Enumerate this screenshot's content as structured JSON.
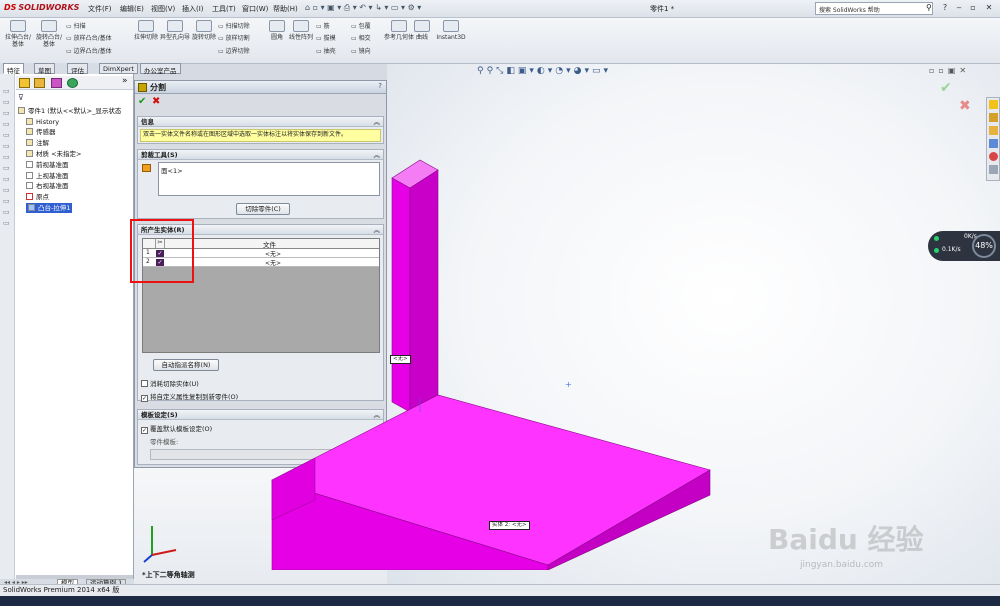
{
  "app": {
    "logo_text": "SOLIDWORKS",
    "doc_title": "零件1 *",
    "search_placeholder": "搜索 SolidWorks 帮助"
  },
  "menu": [
    "文件(F)",
    "编辑(E)",
    "视图(V)",
    "插入(I)",
    "工具(T)",
    "窗口(W)",
    "帮助(H)"
  ],
  "ribbon": {
    "big_buttons": [
      "拉伸凸台/基体",
      "旋转凸台/基体",
      "拉伸切除",
      "异型孔向导",
      "旋转切除",
      "圆角",
      "线性阵列",
      "参考几何体",
      "曲线",
      "Instant3D"
    ],
    "small_buttons": [
      "扫描",
      "放样凸台/基体",
      "边界凸台/基体",
      "扫描切除",
      "放样切割",
      "边界切除",
      "筋",
      "拔模",
      "抽壳",
      "包覆",
      "相交",
      "镜向"
    ]
  },
  "tabs": [
    "特征",
    "草图",
    "评估",
    "DimXpert",
    "办公室产品"
  ],
  "tree": {
    "root": "零件1 (默认<<默认>_显示状态",
    "items": [
      "History",
      "传感器",
      "注解",
      "材质 <未指定>",
      "前视基准面",
      "上视基准面",
      "右视基准面",
      "原点",
      "凸台-拉伸1"
    ]
  },
  "pm": {
    "title": "分割",
    "help": "?",
    "info_header": "信息",
    "info_text": "双击一实体文件名称或在图形区域中选取一实体标注以将实体保存到新文件。",
    "cut_header": "剪裁工具(S)",
    "cut_item": "面<1>",
    "cut_button": "切除零件(C)",
    "bodies_header": "所产生实体(R)",
    "col_file": "文件",
    "rows": [
      {
        "num": "1",
        "file": "<无>"
      },
      {
        "num": "2",
        "file": "<无>"
      }
    ],
    "auto_button": "自动指派名称(N)",
    "consume_label": "消耗切除实体(U)",
    "copy_label": "将自定义属性复制到新零件(O)",
    "template_header": "模板设定(S)",
    "override_label": "覆盖默认模板设定(O)",
    "part_template_label": "零件模板:",
    "browse": "..."
  },
  "viewport": {
    "view_label": "*上下二等角轴测",
    "callout1": "实体 2: <无>",
    "callout2": "<无>",
    "speed_percent": "48%",
    "speed_up": "0K/s",
    "speed_down": "0.1K/s",
    "watermark": "Baidu 经验",
    "watermark_url": "jingyan.baidu.com",
    "body_color": "#ff00ff"
  },
  "bottom_tabs": [
    "模型",
    "运动算例 1"
  ],
  "status": "SolidWorks Premium 2014 x64 版"
}
